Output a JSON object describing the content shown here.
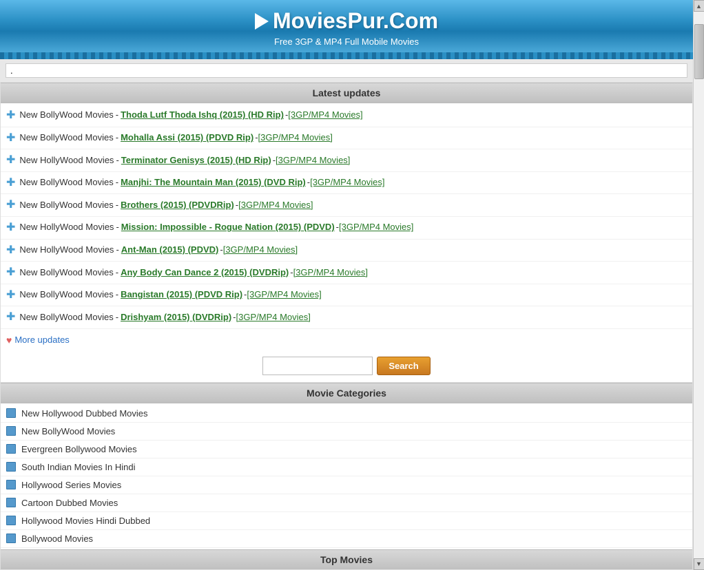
{
  "header": {
    "title": "MoviesPur.Com",
    "subtitle": "Free 3GP & MP4 Full Mobile Movies"
  },
  "top_search": {
    "value": ".",
    "placeholder": ""
  },
  "latest_updates": {
    "section_title": "Latest updates",
    "items": [
      {
        "category": "New BollyWood Movies",
        "title": "Thoda Lutf Thoda Ishq (2015) (HD Rip)",
        "format": "[3GP/MP4 Movies]"
      },
      {
        "category": "New BollyWood Movies",
        "title": "Mohalla Assi (2015) (PDVD Rip)",
        "format": "[3GP/MP4 Movies]"
      },
      {
        "category": "New HollyWood Movies",
        "title": "Terminator Genisys (2015) (HD Rip)",
        "format": "[3GP/MP4 Movies]"
      },
      {
        "category": "New BollyWood Movies",
        "title": "Manjhi: The Mountain Man (2015) (DVD Rip)",
        "format": "[3GP/MP4 Movies]"
      },
      {
        "category": "New BollyWood Movies",
        "title": "Brothers (2015) (PDVDRip)",
        "format": "[3GP/MP4 Movies]"
      },
      {
        "category": "New HollyWood Movies",
        "title": "Mission: Impossible - Rogue Nation (2015) (PDVD)",
        "format": "[3GP/MP4 Movies]"
      },
      {
        "category": "New HollyWood Movies",
        "title": "Ant-Man (2015) (PDVD)",
        "format": "[3GP/MP4 Movies]"
      },
      {
        "category": "New BollyWood Movies",
        "title": "Any Body Can Dance 2 (2015) (DVDRip)",
        "format": "[3GP/MP4 Movies]"
      },
      {
        "category": "New BollyWood Movies",
        "title": "Bangistan (2015) (PDVD Rip)",
        "format": "[3GP/MP4 Movies]"
      },
      {
        "category": "New BollyWood Movies",
        "title": "Drishyam (2015) (DVDRip)",
        "format": "[3GP/MP4 Movies]"
      }
    ],
    "more_label": "More updates"
  },
  "search": {
    "input_placeholder": "",
    "button_label": "Search"
  },
  "movie_categories": {
    "section_title": "Movie Categories",
    "items": [
      "New Hollywood Dubbed Movies",
      "New BollyWood Movies",
      "Evergreen Bollywood Movies",
      "South Indian Movies In Hindi",
      "Hollywood Series Movies",
      "Cartoon Dubbed Movies",
      "Hollywood Movies Hindi Dubbed",
      "Bollywood Movies"
    ]
  },
  "top_movies": {
    "section_title": "Top Movies"
  }
}
